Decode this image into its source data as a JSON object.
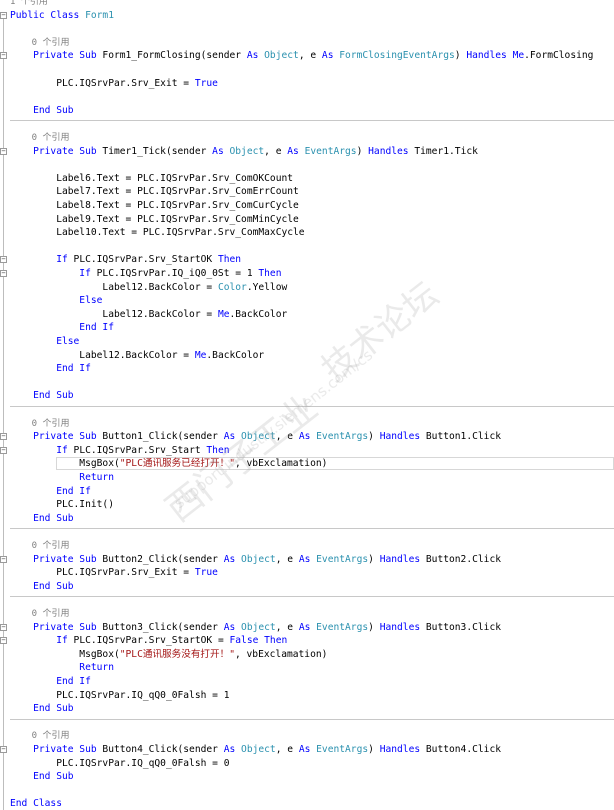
{
  "editor": {
    "lines": [
      [
        [
          "1 个引用",
          "ref"
        ]
      ],
      [
        [
          "Public Class ",
          "kw"
        ],
        [
          "Form1",
          "ty"
        ]
      ],
      [],
      [
        [
          "    0 个引用",
          "ref"
        ]
      ],
      [
        [
          "    Private Sub ",
          "kw"
        ],
        [
          "Form1_FormClosing(sender ",
          ""
        ],
        [
          "As ",
          "kw"
        ],
        [
          "Object",
          "ty"
        ],
        [
          ", e ",
          ""
        ],
        [
          "As ",
          "kw"
        ],
        [
          "FormClosingEventArgs",
          "ty"
        ],
        [
          ") ",
          ""
        ],
        [
          "Handles ",
          "kw"
        ],
        [
          "Me",
          "kw"
        ],
        [
          ".FormClosing",
          ""
        ]
      ],
      [],
      [
        [
          "        PLC.IQSrvPar.Srv_Exit = ",
          ""
        ],
        [
          "True",
          "kw"
        ]
      ],
      [],
      [
        [
          "    End Sub",
          "kw"
        ]
      ],
      [],
      [
        [
          "    0 个引用",
          "ref"
        ]
      ],
      [
        [
          "    Private Sub ",
          "kw"
        ],
        [
          "Timer1_Tick(sender ",
          ""
        ],
        [
          "As ",
          "kw"
        ],
        [
          "Object",
          "ty"
        ],
        [
          ", e ",
          ""
        ],
        [
          "As ",
          "kw"
        ],
        [
          "EventArgs",
          "ty"
        ],
        [
          ") ",
          ""
        ],
        [
          "Handles ",
          "kw"
        ],
        [
          "Timer1.Tick",
          ""
        ]
      ],
      [],
      [
        [
          "        Label6.Text = PLC.IQSrvPar.Srv_ComOKCount",
          ""
        ]
      ],
      [
        [
          "        Label7.Text = PLC.IQSrvPar.Srv_ComErrCount",
          ""
        ]
      ],
      [
        [
          "        Label8.Text = PLC.IQSrvPar.Srv_ComCurCycle",
          ""
        ]
      ],
      [
        [
          "        Label9.Text = PLC.IQSrvPar.Srv_ComMinCycle",
          ""
        ]
      ],
      [
        [
          "        Label10.Text = PLC.IQSrvPar.Srv_ComMaxCycle",
          ""
        ]
      ],
      [],
      [
        [
          "        If ",
          "kw"
        ],
        [
          "PLC.IQSrvPar.Srv_StartOK ",
          ""
        ],
        [
          "Then",
          "kw"
        ]
      ],
      [
        [
          "            If ",
          "kw"
        ],
        [
          "PLC.IQSrvPar.IQ_iQ0_0St = 1 ",
          ""
        ],
        [
          "Then",
          "kw"
        ]
      ],
      [
        [
          "                Label12.BackColor = ",
          ""
        ],
        [
          "Color",
          "ty"
        ],
        [
          ".Yellow",
          ""
        ]
      ],
      [
        [
          "            Else",
          "kw"
        ]
      ],
      [
        [
          "                Label12.BackColor = ",
          ""
        ],
        [
          "Me",
          "kw"
        ],
        [
          ".BackColor",
          ""
        ]
      ],
      [
        [
          "            End If",
          "kw"
        ]
      ],
      [
        [
          "        Else",
          "kw"
        ]
      ],
      [
        [
          "            Label12.BackColor = ",
          ""
        ],
        [
          "Me",
          "kw"
        ],
        [
          ".BackColor",
          ""
        ]
      ],
      [
        [
          "        End If",
          "kw"
        ]
      ],
      [],
      [
        [
          "    End Sub",
          "kw"
        ]
      ],
      [],
      [
        [
          "    0 个引用",
          "ref"
        ]
      ],
      [
        [
          "    Private Sub ",
          "kw"
        ],
        [
          "Button1_Click(sender ",
          ""
        ],
        [
          "As ",
          "kw"
        ],
        [
          "Object",
          "ty"
        ],
        [
          ", e ",
          ""
        ],
        [
          "As ",
          "kw"
        ],
        [
          "EventArgs",
          "ty"
        ],
        [
          ") ",
          ""
        ],
        [
          "Handles ",
          "kw"
        ],
        [
          "Button1.Click",
          ""
        ]
      ],
      [
        [
          "        If ",
          "kw"
        ],
        [
          "PLC.IQSrvPar.Srv_Start ",
          ""
        ],
        [
          "Then",
          "kw"
        ]
      ],
      [
        [
          "            MsgBox(",
          ""
        ],
        [
          "\"PLC通讯服务已经打开！\"",
          "str"
        ],
        [
          ", vbExclamation)",
          ""
        ]
      ],
      [
        [
          "            Return",
          "kw"
        ]
      ],
      [
        [
          "        End If",
          "kw"
        ]
      ],
      [
        [
          "        PLC.Init()",
          ""
        ]
      ],
      [
        [
          "    End Sub",
          "kw"
        ]
      ],
      [],
      [
        [
          "    0 个引用",
          "ref"
        ]
      ],
      [
        [
          "    Private Sub ",
          "kw"
        ],
        [
          "Button2_Click(sender ",
          ""
        ],
        [
          "As ",
          "kw"
        ],
        [
          "Object",
          "ty"
        ],
        [
          ", e ",
          ""
        ],
        [
          "As ",
          "kw"
        ],
        [
          "EventArgs",
          "ty"
        ],
        [
          ") ",
          ""
        ],
        [
          "Handles ",
          "kw"
        ],
        [
          "Button2.Click",
          ""
        ]
      ],
      [
        [
          "        PLC.IQSrvPar.Srv_Exit = ",
          ""
        ],
        [
          "True",
          "kw"
        ]
      ],
      [
        [
          "    End Sub",
          "kw"
        ]
      ],
      [],
      [
        [
          "    0 个引用",
          "ref"
        ]
      ],
      [
        [
          "    Private Sub ",
          "kw"
        ],
        [
          "Button3_Click(sender ",
          ""
        ],
        [
          "As ",
          "kw"
        ],
        [
          "Object",
          "ty"
        ],
        [
          ", e ",
          ""
        ],
        [
          "As ",
          "kw"
        ],
        [
          "EventArgs",
          "ty"
        ],
        [
          ") ",
          ""
        ],
        [
          "Handles ",
          "kw"
        ],
        [
          "Button3.Click",
          ""
        ]
      ],
      [
        [
          "        If ",
          "kw"
        ],
        [
          "PLC.IQSrvPar.Srv_StartOK = ",
          ""
        ],
        [
          "False ",
          "kw"
        ],
        [
          "Then",
          "kw"
        ]
      ],
      [
        [
          "            MsgBox(",
          ""
        ],
        [
          "\"PLC通讯服务没有打开！\"",
          "str"
        ],
        [
          ", vbExclamation)",
          ""
        ]
      ],
      [
        [
          "            Return",
          "kw"
        ]
      ],
      [
        [
          "        End If",
          "kw"
        ]
      ],
      [
        [
          "        PLC.IQSrvPar.IQ_qQ0_0Falsh = 1",
          ""
        ]
      ],
      [
        [
          "    End Sub",
          "kw"
        ]
      ],
      [],
      [
        [
          "    0 个引用",
          "ref"
        ]
      ],
      [
        [
          "    Private Sub ",
          "kw"
        ],
        [
          "Button4_Click(sender ",
          ""
        ],
        [
          "As ",
          "kw"
        ],
        [
          "Object",
          "ty"
        ],
        [
          ", e ",
          ""
        ],
        [
          "As ",
          "kw"
        ],
        [
          "EventArgs",
          "ty"
        ],
        [
          ") ",
          ""
        ],
        [
          "Handles ",
          "kw"
        ],
        [
          "Button4.Click",
          ""
        ]
      ],
      [
        [
          "        PLC.IQSrvPar.IQ_qQ0_0Falsh = 0",
          ""
        ]
      ],
      [
        [
          "    End Sub",
          "kw"
        ]
      ],
      [],
      [
        [
          "End Class",
          "kw"
        ]
      ]
    ]
  },
  "watermark": {
    "line1": "西门子工业",
    "line2": "support.industry.siemens.com/cs",
    "line3": "技术论坛"
  }
}
